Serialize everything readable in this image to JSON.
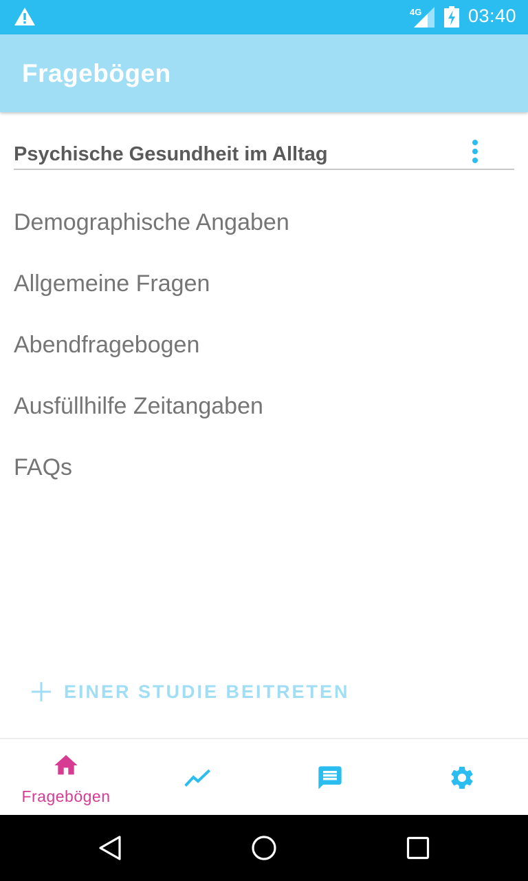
{
  "status_bar": {
    "network_type": "4G",
    "time": "03:40",
    "background_color": "#2BBDF0",
    "icons": [
      "warning-icon",
      "signal-icon",
      "battery-charging-icon"
    ]
  },
  "app_bar": {
    "title": "Fragebögen",
    "background_color": "#A0DEF5"
  },
  "study": {
    "name": "Psychische Gesundheit im Alltag",
    "menu_icon": "more-vertical-icon"
  },
  "questionnaires": [
    {
      "label": "Demographische Angaben"
    },
    {
      "label": "Allgemeine Fragen"
    },
    {
      "label": "Abendfragebogen"
    },
    {
      "label": "Ausfüllhilfe Zeitangaben"
    },
    {
      "label": "FAQs"
    }
  ],
  "join_study": {
    "label": "EINER STUDIE BEITRETEN",
    "icon": "plus-icon"
  },
  "bottom_nav": {
    "active_color": "#D63D92",
    "inactive_color": "#2BBDF0",
    "items": [
      {
        "id": "home",
        "label": "Fragebögen",
        "icon": "home-icon",
        "active": true
      },
      {
        "id": "stats",
        "label": "",
        "icon": "trending-up-icon",
        "active": false
      },
      {
        "id": "messages",
        "label": "",
        "icon": "message-icon",
        "active": false
      },
      {
        "id": "settings",
        "label": "",
        "icon": "gear-icon",
        "active": false
      }
    ]
  },
  "system_nav": {
    "icons": [
      "back-icon",
      "home-circle-icon",
      "recents-icon"
    ]
  }
}
